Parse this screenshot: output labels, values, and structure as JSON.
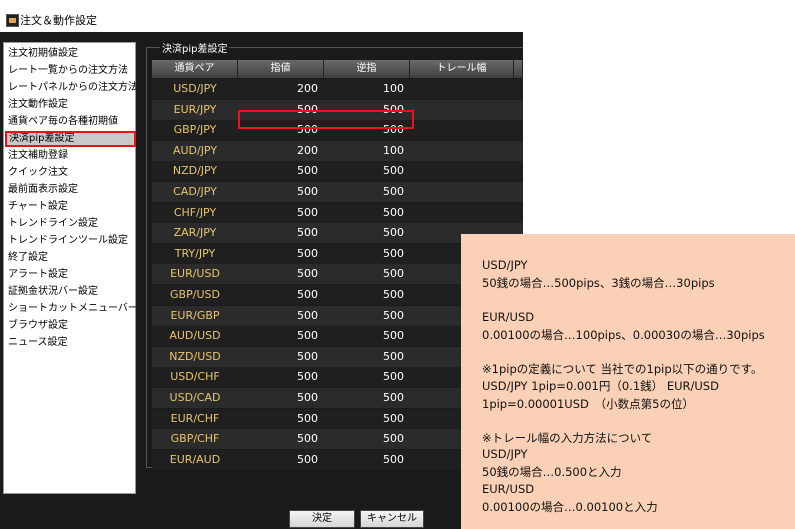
{
  "window": {
    "title": "注文＆動作設定"
  },
  "sidebar": {
    "items": [
      {
        "label": "注文初期値設定"
      },
      {
        "label": "レート一覧からの注文方法"
      },
      {
        "label": "レートパネルからの注文方法"
      },
      {
        "label": "注文動作設定"
      },
      {
        "label": "通貨ペア毎の各種初期値"
      },
      {
        "label": "決済pip差設定"
      },
      {
        "label": "注文補助登録"
      },
      {
        "label": "クイック注文"
      },
      {
        "label": "最前面表示設定"
      },
      {
        "label": "チャート設定"
      },
      {
        "label": "トレンドライン設定"
      },
      {
        "label": "トレンドラインツール設定"
      },
      {
        "label": "終了設定"
      },
      {
        "label": "アラート設定"
      },
      {
        "label": "証拠金状況バー設定"
      },
      {
        "label": "ショートカットメニューバー設定"
      },
      {
        "label": "ブラウザ設定"
      },
      {
        "label": "ニュース設定"
      }
    ],
    "selected_index": 5
  },
  "panel": {
    "group_title": "決済pip差設定",
    "columns": [
      "通貨ペア",
      "指値",
      "逆指",
      "トレール幅"
    ],
    "rows": [
      {
        "pair": "USD/JPY",
        "limit": "200",
        "stop": "100"
      },
      {
        "pair": "EUR/JPY",
        "limit": "500",
        "stop": "500"
      },
      {
        "pair": "GBP/JPY",
        "limit": "500",
        "stop": "500"
      },
      {
        "pair": "AUD/JPY",
        "limit": "200",
        "stop": "100"
      },
      {
        "pair": "NZD/JPY",
        "limit": "500",
        "stop": "500"
      },
      {
        "pair": "CAD/JPY",
        "limit": "500",
        "stop": "500"
      },
      {
        "pair": "CHF/JPY",
        "limit": "500",
        "stop": "500"
      },
      {
        "pair": "ZAR/JPY",
        "limit": "500",
        "stop": "500"
      },
      {
        "pair": "TRY/JPY",
        "limit": "500",
        "stop": "500"
      },
      {
        "pair": "EUR/USD",
        "limit": "500",
        "stop": "500"
      },
      {
        "pair": "GBP/USD",
        "limit": "500",
        "stop": "500"
      },
      {
        "pair": "EUR/GBP",
        "limit": "500",
        "stop": "500"
      },
      {
        "pair": "AUD/USD",
        "limit": "500",
        "stop": "500"
      },
      {
        "pair": "NZD/USD",
        "limit": "500",
        "stop": "500"
      },
      {
        "pair": "USD/CHF",
        "limit": "500",
        "stop": "500"
      },
      {
        "pair": "USD/CAD",
        "limit": "500",
        "stop": "500"
      },
      {
        "pair": "EUR/CHF",
        "limit": "500",
        "stop": "500"
      },
      {
        "pair": "GBP/CHF",
        "limit": "500",
        "stop": "500"
      },
      {
        "pair": "EUR/AUD",
        "limit": "500",
        "stop": "500"
      }
    ]
  },
  "buttons": {
    "ok": "決定",
    "cancel": "キャンセル"
  },
  "note": {
    "lines": [
      "USD/JPY",
      "50銭の場合…500pips、3銭の場合…30pips",
      "",
      "EUR/USD",
      "0.00100の場合…100pips、0.00030の場合…30pips",
      "",
      "※1pipの定義について 当社での1pip以下の通りです。",
      "USD/JPY 1pip=0.001円（0.1銭） EUR/USD",
      "1pip=0.00001USD　（小数点第5の位）",
      "",
      "※トレール幅の入力方法について",
      "USD/JPY",
      "50銭の場合…0.500と入力",
      "EUR/USD",
      "0.00100の場合…0.00100と入力"
    ]
  },
  "colors": {
    "highlight": "#e8131a",
    "note_bg": "#fad1b6",
    "pair_text": "#e8c56a"
  }
}
